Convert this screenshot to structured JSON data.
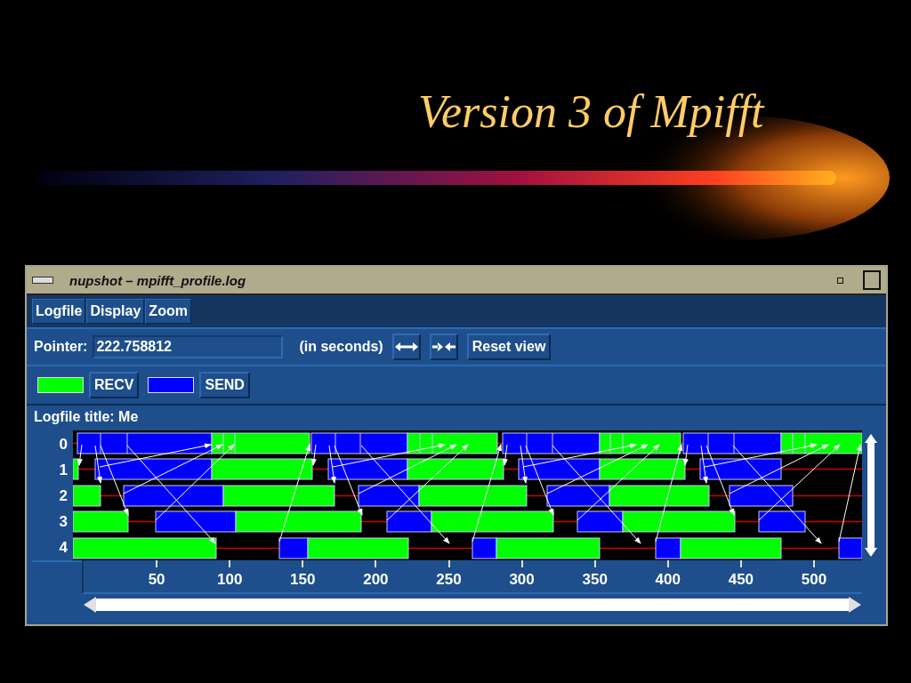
{
  "slide": {
    "title": "Version 3 of Mpifft"
  },
  "window": {
    "title": "nupshot – mpifft_profile.log"
  },
  "menu": [
    {
      "label": "Logfile"
    },
    {
      "label": "Display"
    },
    {
      "label": "Zoom"
    }
  ],
  "pointer": {
    "label": "Pointer:",
    "value": "222.758812",
    "unit": "(in seconds)"
  },
  "buttons": [
    {
      "kind": "expand"
    },
    {
      "kind": "shrink"
    },
    {
      "kind": "text",
      "label": "Reset view"
    }
  ],
  "legend": [
    {
      "label": "RECV",
      "color": "#00ff00"
    },
    {
      "label": "SEND",
      "color": "#0000ff"
    }
  ],
  "logfile_title": "Logfile title: Me",
  "timeline": {
    "rows": [
      "0",
      "1",
      "2",
      "3",
      "4"
    ],
    "ticks": [
      "50",
      "100",
      "150",
      "200",
      "250",
      "300",
      "350",
      "400",
      "450",
      "500"
    ]
  }
}
